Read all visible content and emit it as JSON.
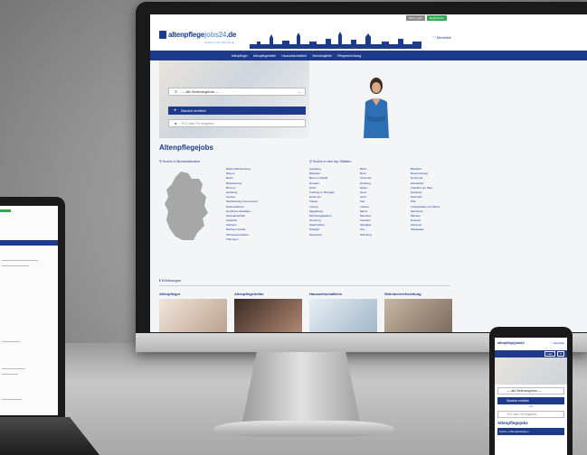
{
  "site": {
    "logo_main": "altenpflege",
    "logo_accent": "jobs24",
    "logo_tld": ".de",
    "logo_sub": "Stellen in der Altenpflege",
    "login_label": "Mein Login",
    "register_label": "Registrieren",
    "merkliste_label": "♡ Merkliste"
  },
  "nav": {
    "items": [
      "Altenpfleger",
      "Altenpflegehelfer",
      "Hauswirtschafterin",
      "Wohnbegleiter",
      "Pflegeeinrichtung"
    ]
  },
  "hero": {
    "select_placeholder": "— alle Stellenangebote —",
    "standort_label": "Standort ermitteln",
    "plz_placeholder": "PLZ oder Ort eingeben"
  },
  "main": {
    "title": "Altenpflegejobs",
    "bundesland_heading": "Suche in Bundesländern",
    "staedte_heading": "Suche in den top Städten",
    "bundeslaender": [
      "Baden-Württemberg",
      "Bayern",
      "Berlin",
      "Brandenburg",
      "Bremen",
      "Hamburg",
      "Hessen",
      "Mecklenburg-Vorpommern",
      "Niedersachsen",
      "Nordrhein-Westfalen",
      "Rheinland-Pfalz",
      "Saarland",
      "Sachsen",
      "Sachsen-Anhalt",
      "Schleswig-Holstein",
      "Thüringen"
    ],
    "staedte_col1": [
      "Augsburg",
      "Bielefeld",
      "Bremen (Stadt)",
      "Dresden",
      "Erfurt",
      "Freiburg im Breisgau",
      "Hannover",
      "Kassel",
      "Leipzig",
      "Magdeburg",
      "Mönchengladbach",
      "Nürnberg",
      "Saarbrücken",
      "Stuttgart",
      "Wuppertal"
    ],
    "staedte_col2": [
      "Berlin",
      "Bonn",
      "Chemnitz",
      "Duisburg",
      "Essen",
      "Gera",
      "Jena",
      "Kiel",
      "Lübeck",
      "Mainz",
      "München",
      "Potsdam",
      "Salzgitter",
      "Ulm",
      "Würzburg"
    ],
    "staedte_col3": [
      "Bielefeld",
      "Braunschweig",
      "Dortmund",
      "Düsseldorf",
      "Frankfurt am Main",
      "Hamburg",
      "Karlsruhe",
      "Köln",
      "Ludwigshafen am Rhein",
      "Mannheim",
      "Münster",
      "Rostock",
      "Schwerin",
      "Wiesbaden"
    ],
    "erklaerungen_heading": "Erklärungen",
    "cards": [
      "Altenpfleger",
      "Altenpflegehelfer",
      "Hauswirtschafterin",
      "Wohnbereichsleitung"
    ]
  },
  "phone": {
    "logo": "altenpflegejobs24",
    "merkliste": "♡ Merkliste",
    "login": "Login",
    "menu": "☰",
    "select_placeholder": "— alle Stellenangebote —",
    "standort_label": "Standort ermitteln",
    "oder": "oder",
    "plz_placeholder": "PLZ oder Ort eingeben",
    "title": "Altenpflegejobs",
    "sub": "Suche in Bundesländern"
  },
  "colors": {
    "brand_blue": "#1e3a8a",
    "accent_light": "#6fa0d8",
    "green": "#36a852"
  }
}
